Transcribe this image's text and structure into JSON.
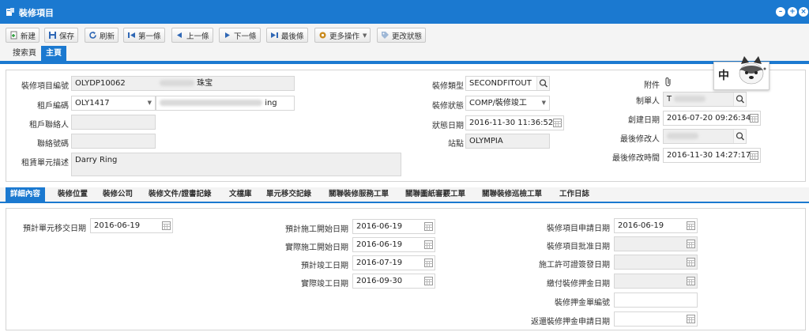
{
  "window": {
    "title": "裝修項目"
  },
  "toolbar": {
    "new": "新建",
    "save": "保存",
    "refresh": "刷新",
    "first": "第一條",
    "prev": "上一條",
    "next": "下一條",
    "last": "最後條",
    "more_actions": "更多操作",
    "change_status": "更改狀態"
  },
  "top_tabs": [
    "搜索頁",
    "主頁"
  ],
  "form": {
    "project_no": {
      "label": "裝修項目編號",
      "value": "OLYDP10062",
      "value2": "珠宝"
    },
    "tenant_code": {
      "label": "租戶編碼",
      "value": "OLY1417",
      "value2": "ing"
    },
    "tenant_contact": {
      "label": "租戶聯絡人",
      "value": ""
    },
    "contact_no": {
      "label": "聯絡號碼",
      "value": ""
    },
    "unit_desc": {
      "label": "租賃單元描述",
      "value": "Darry Ring"
    },
    "fitout_type": {
      "label": "裝修類型",
      "value": "SECONDFITOUT"
    },
    "fitout_status": {
      "label": "裝修狀態",
      "value": "COMP/裝修竣工"
    },
    "status_date": {
      "label": "狀態日期",
      "value": "2016-11-30 11:36:52"
    },
    "site": {
      "label": "站點",
      "value": "OLYMPIA"
    },
    "attachment": {
      "label": "附件"
    },
    "creator": {
      "label": "制單人",
      "value": "T"
    },
    "created_date": {
      "label": "創建日期",
      "value": "2016-07-20 09:26:34"
    },
    "last_modifier": {
      "label": "最後修改人",
      "value": ""
    },
    "last_modified_time": {
      "label": "最後修改時間",
      "value": "2016-11-30 14:27:17"
    }
  },
  "ime_badge": "中",
  "sub_tabs": [
    "詳細內容",
    "裝修位置",
    "裝修公司",
    "裝修文件/證書記錄",
    "文檔庫",
    "單元移交記錄",
    "關聯裝修服務工單",
    "關聯圖紙審覈工單",
    "關聯裝修巡檢工單",
    "工作日誌"
  ],
  "details": {
    "planned_handover": {
      "label": "預計單元移交日期",
      "value": "2016-06-19"
    },
    "planned_start": {
      "label": "預計施工開始日期",
      "value": "2016-06-19"
    },
    "actual_start": {
      "label": "實際施工開始日期",
      "value": "2016-06-19"
    },
    "planned_completion": {
      "label": "預計竣工日期",
      "value": "2016-07-19"
    },
    "actual_completion": {
      "label": "實際竣工日期",
      "value": "2016-09-30"
    },
    "application_date": {
      "label": "裝修項目申請日期",
      "value": "2016-06-19"
    },
    "approval_date": {
      "label": "裝修項目批准日期",
      "value": ""
    },
    "permit_issue_date": {
      "label": "施工許可證簽發日期",
      "value": ""
    },
    "deposit_pay_date": {
      "label": "繳付裝修押金日期",
      "value": ""
    },
    "deposit_doc_no": {
      "label": "裝修押金單編號",
      "value": ""
    },
    "deposit_refund_date": {
      "label": "返還裝修押金申請日期",
      "value": ""
    }
  },
  "colors": {
    "accent": "#1b79d0",
    "field_bg": "#efefef"
  }
}
